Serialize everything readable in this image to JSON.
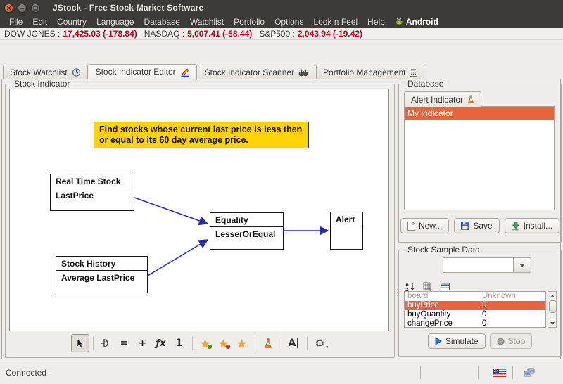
{
  "window": {
    "title": "JStock - Free Stock Market Software",
    "menu_items": [
      "File",
      "Edit",
      "Country",
      "Language",
      "Database",
      "Watchlist",
      "Portfolio",
      "Options",
      "Look n Feel",
      "Help"
    ],
    "android_menu": "Android"
  },
  "ticker": {
    "indices": [
      {
        "label": "DOW JONES :",
        "value": "17,425.03 (-178.84)"
      },
      {
        "label": "NASDAQ :",
        "value": "5,007.41 (-58.44)"
      },
      {
        "label": "S&P500 :",
        "value": "2,043.94 (-19.42)"
      }
    ]
  },
  "tabs": [
    {
      "label": "Stock Watchlist",
      "icon": "watch-icon",
      "selected": false
    },
    {
      "label": "Stock Indicator Editor",
      "icon": "pencil-icon",
      "selected": true
    },
    {
      "label": "Stock Indicator Scanner",
      "icon": "binoculars-icon",
      "selected": false
    },
    {
      "label": "Portfolio Management",
      "icon": "calculator-icon",
      "selected": false
    }
  ],
  "editor": {
    "panel_title": "Stock Indicator",
    "note": "Find stocks whose current last price is less then or equal to its 60 day average price.",
    "nodes": [
      {
        "title": "Real Time Stock",
        "body": "LastPrice"
      },
      {
        "title": "Stock History",
        "body": "Average LastPrice"
      },
      {
        "title": "Equality",
        "body": "LesserOrEqual"
      },
      {
        "title": "Alert",
        "body": ""
      }
    ],
    "toolbar": [
      {
        "name": "pointer-tool",
        "glyph": ""
      },
      {
        "name": "operator-tool",
        "glyph": ""
      },
      {
        "name": "equality-tool",
        "glyph": "="
      },
      {
        "name": "arithmetic-tool",
        "glyph": "+"
      },
      {
        "name": "function-tool",
        "glyph": "ƒx"
      },
      {
        "name": "constant-tool",
        "glyph": "1"
      },
      {
        "name": "star-add-tool",
        "glyph": ""
      },
      {
        "name": "star-remove-tool",
        "glyph": ""
      },
      {
        "name": "star-tool",
        "glyph": ""
      },
      {
        "name": "alert-tool",
        "glyph": ""
      },
      {
        "name": "text-tool",
        "glyph": "A|"
      },
      {
        "name": "settings-tool",
        "glyph": ""
      }
    ]
  },
  "database": {
    "panel_title": "Database",
    "tab_label": "Alert Indicator",
    "items": [
      {
        "label": "My indicator",
        "selected": true
      }
    ],
    "buttons": {
      "new": "New...",
      "save": "Save",
      "install": "Install..."
    }
  },
  "sample_data": {
    "panel_title": "Stock Sample Data",
    "combo_value": "",
    "table_rows": [
      {
        "key": "board",
        "value": "Unknown",
        "dim": true,
        "selected": false
      },
      {
        "key": "buyPrice",
        "value": "0",
        "dim": false,
        "selected": true
      },
      {
        "key": "buyQuantity",
        "value": "0",
        "dim": false,
        "selected": false
      },
      {
        "key": "changePrice",
        "value": "0",
        "dim": false,
        "selected": false
      }
    ],
    "buttons": {
      "simulate": "Simulate",
      "stop": "Stop"
    }
  },
  "statusbar": {
    "text": "Connected"
  },
  "colors": {
    "accent_orange": "#e8643c",
    "ticker_red": "#c00020",
    "note_yellow": "#ffd400",
    "wire_blue": "#2a2ab0",
    "android_green": "#a4c639",
    "titlebar": "#3c3b37"
  }
}
